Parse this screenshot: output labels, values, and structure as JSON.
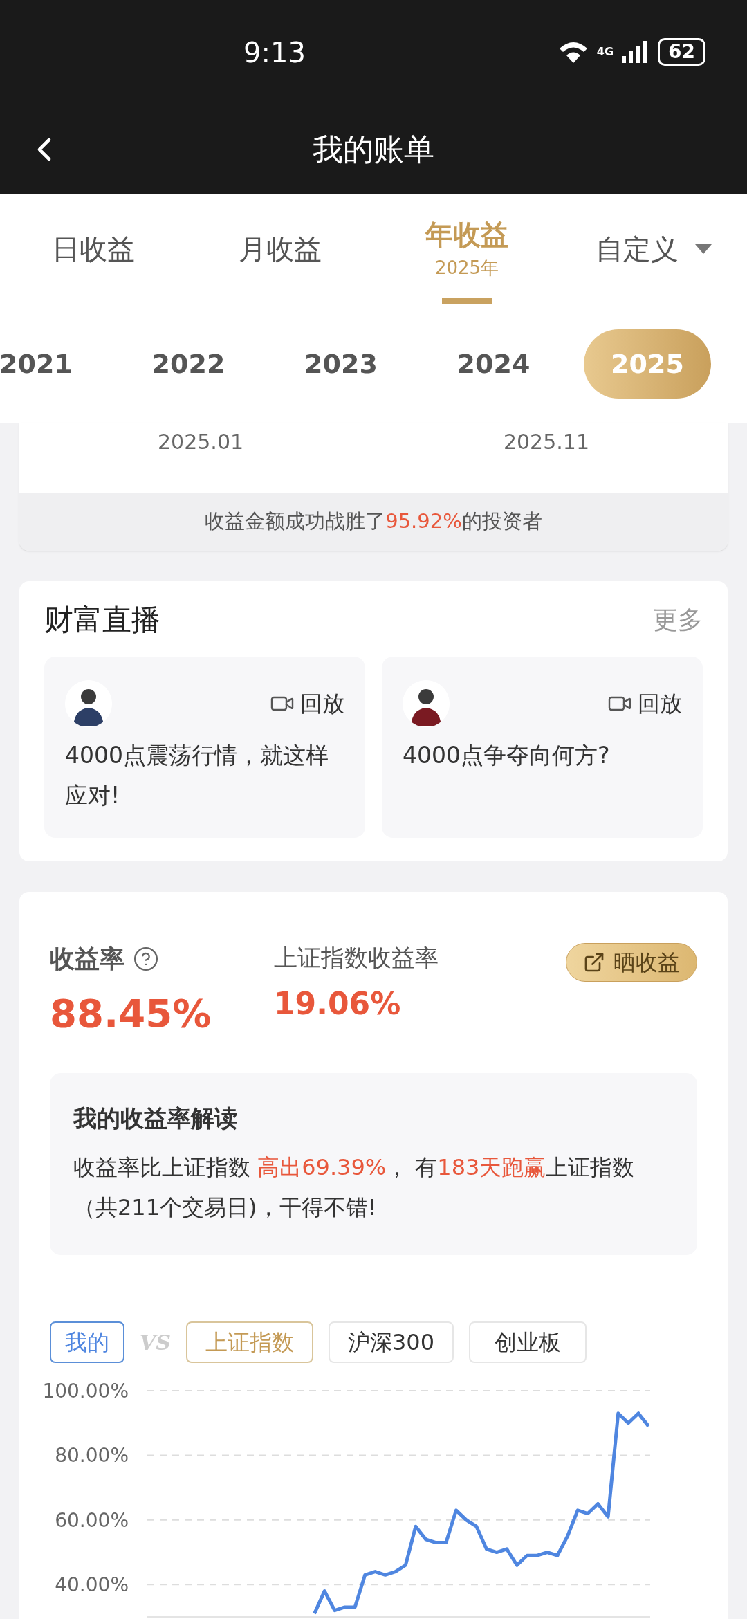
{
  "status_bar": {
    "time": "9:13",
    "network": "4G",
    "battery": "62"
  },
  "header": {
    "title": "我的账单"
  },
  "period_tabs": [
    {
      "label": "日收益",
      "selected": false
    },
    {
      "label": "月收益",
      "selected": false
    },
    {
      "label": "年收益",
      "sub": "2025年",
      "selected": true
    },
    {
      "label": "自定义",
      "kind": "dropdown",
      "selected": false
    }
  ],
  "years": [
    {
      "label": "2021",
      "selected": false
    },
    {
      "label": "2022",
      "selected": false
    },
    {
      "label": "2023",
      "selected": false
    },
    {
      "label": "2024",
      "selected": false
    },
    {
      "label": "2025",
      "selected": true
    }
  ],
  "earnings_card": {
    "axis_labels": [
      "2025.01",
      "2025.11"
    ],
    "rank_parts": [
      {
        "text": "收益金额成功战胜了",
        "highlight": false
      },
      {
        "text": "95.92%",
        "highlight": true
      },
      {
        "text": "的投资者",
        "highlight": false
      }
    ]
  },
  "live": {
    "title": "财富直播",
    "more": "更多",
    "items": [
      {
        "badge": "回放",
        "title": "4000点震荡行情，就这样应对!"
      },
      {
        "badge": "回放",
        "title": "4000点争夺向何方?"
      }
    ]
  },
  "returns": {
    "label": "收益率",
    "value": "88.45%",
    "index_label": "上证指数收益率",
    "index_value": "19.06%",
    "share": "晒收益",
    "interpretation": {
      "title": "我的收益率解读",
      "parts": [
        {
          "text": "收益率比上证指数 ",
          "highlight": false
        },
        {
          "text": "高出69.39%",
          "highlight": true
        },
        {
          "text": "， 有",
          "highlight": false
        },
        {
          "text": "183天跑赢",
          "highlight": true
        },
        {
          "text": "上证指数（共211个交易日)，干得不错!",
          "highlight": false
        }
      ]
    },
    "compare": {
      "vs": "VS",
      "options": [
        {
          "label": "上证指数",
          "selected": true
        },
        {
          "label": "沪深300",
          "selected": false
        },
        {
          "label": "创业板",
          "selected": false
        }
      ]
    },
    "chart_data": {
      "type": "line",
      "grid": true,
      "ylim": [
        30,
        100
      ],
      "yticks": [
        {
          "value": 100,
          "label": "100.00%"
        },
        {
          "value": 80,
          "label": "80.00%"
        },
        {
          "value": 60,
          "label": "60.00%"
        },
        {
          "value": 40,
          "label": "40.00%"
        }
      ],
      "categories": [
        null,
        null,
        null,
        null,
        null,
        null,
        null,
        null,
        null,
        null,
        null,
        null,
        null,
        null,
        null,
        null,
        null,
        null,
        null,
        null,
        null,
        null,
        null,
        null,
        null,
        null,
        null,
        null,
        null,
        null,
        null,
        null,
        null,
        null,
        null,
        null,
        null,
        null,
        null,
        null,
        null,
        null,
        null,
        null,
        null,
        null,
        null,
        null,
        null,
        null
      ],
      "series": [
        {
          "name": "我的",
          "color": "#4f86e0",
          "values": [
            null,
            null,
            null,
            null,
            null,
            null,
            null,
            null,
            null,
            null,
            null,
            null,
            null,
            null,
            null,
            null,
            31,
            38,
            32,
            33,
            33,
            43,
            44,
            43,
            44,
            46,
            58,
            54,
            53,
            53,
            63,
            60,
            58,
            51,
            50,
            51,
            46,
            49,
            49,
            50,
            49,
            55,
            63,
            62,
            65,
            61,
            93,
            90,
            93,
            89
          ]
        }
      ]
    }
  }
}
